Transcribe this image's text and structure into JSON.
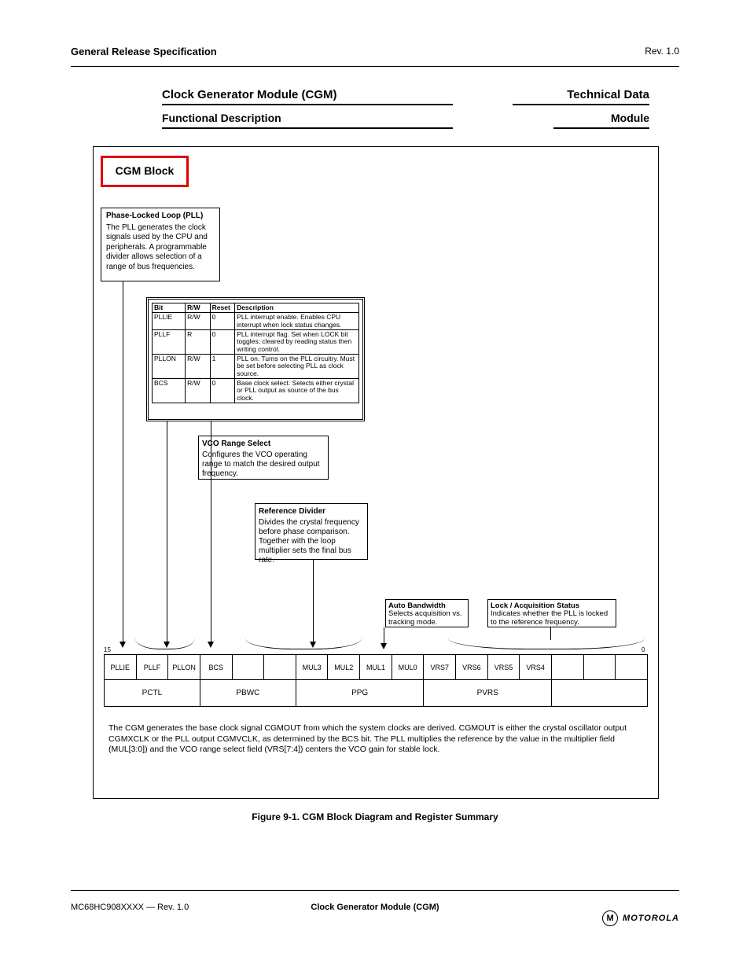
{
  "header": {
    "left": "General Release Specification",
    "right": "Rev. 1.0"
  },
  "section": {
    "line1_left": "Clock Generator Module (CGM)",
    "line2_left": "Functional Description",
    "line1_right": "Technical Data",
    "line2_right": "Module"
  },
  "red_box": "CGM Block",
  "box1": {
    "title": "Phase-Locked Loop (PLL)",
    "body": "The PLL generates the clock signals used by the CPU and peripherals. A programmable divider allows selection of a range of bus frequencies."
  },
  "cgm_table": {
    "header": [
      "Bit",
      "R/W",
      "Reset",
      "Description"
    ],
    "rows": [
      [
        "PLLIE",
        "R/W",
        "0",
        "PLL interrupt enable. Enables CPU interrupt when lock status changes."
      ],
      [
        "PLLF",
        "R",
        "0",
        "PLL interrupt flag. Set when LOCK bit toggles; cleared by reading status then writing control."
      ],
      [
        "PLLON",
        "R/W",
        "1",
        "PLL on. Turns on the PLL circuitry. Must be set before selecting PLL as clock source."
      ],
      [
        "BCS",
        "R/W",
        "0",
        "Base clock select. Selects either crystal or PLL output as source of the bus clock."
      ]
    ]
  },
  "box3": {
    "title": "VCO Range Select",
    "body": "Configures the VCO operating range to match the desired output frequency."
  },
  "box4": {
    "title": "Reference Divider",
    "body": "Divides the crystal frequency before phase comparison. Together with the loop multiplier sets the final bus rate."
  },
  "box5": {
    "title": "Auto Bandwidth",
    "body": "Selects acquisition vs. tracking mode."
  },
  "box6": {
    "title": "Lock / Acquisition Status",
    "body": "Indicates whether the PLL is locked to the reference frequency."
  },
  "bit_numbers_left": "15",
  "bit_numbers_right": "0",
  "bit_cells": [
    "PLLIE",
    "PLLF",
    "PLLON",
    "BCS",
    "",
    "",
    "MUL3",
    "MUL2",
    "MUL1",
    "MUL0",
    "VRS7",
    "VRS6",
    "VRS5",
    "VRS4",
    "",
    "",
    ""
  ],
  "label_cells": [
    "PCTL",
    "",
    "PBWC",
    "",
    "PPG",
    "",
    "PVRS",
    "",
    ""
  ],
  "body_text": "The CGM generates the base clock signal CGMOUT from which the system clocks are derived. CGMOUT is either the crystal oscillator output CGMXCLK or the PLL output CGMVCLK, as determined by the BCS bit. The PLL multiplies the reference by the value in the multiplier field (MUL[3:0]) and the VCO range select field (VRS[7:4]) centers the VCO gain for stable lock.",
  "figure_caption": "Figure 9-1. CGM Block Diagram and Register Summary",
  "footer": {
    "left": "MC68HC908XXXX — Rev. 1.0",
    "mid": "MOTOROLA",
    "page": "Clock Generator Module (CGM)"
  },
  "logo_letter": "M",
  "logo_text": "MOTOROLA"
}
